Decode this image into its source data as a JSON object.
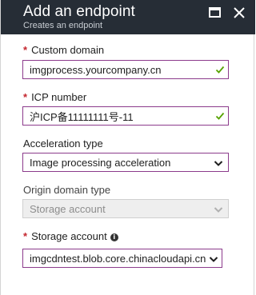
{
  "header": {
    "title": "Add an endpoint",
    "subtitle": "Creates an endpoint",
    "maximize_icon": "maximize-icon",
    "close_icon": "close-icon",
    "background_color": "#262d36"
  },
  "form": {
    "required_marker": "*",
    "custom_domain": {
      "label": "Custom domain",
      "value": "imgprocess.yourcompany.cn",
      "valid": true
    },
    "icp_number": {
      "label": "ICP number",
      "value": "沪ICP备11111111号-11",
      "valid": true
    },
    "acceleration_type": {
      "label": "Acceleration type",
      "selected": "Image processing acceleration"
    },
    "origin_domain_type": {
      "label": "Origin domain type",
      "selected": "Storage account",
      "disabled": true
    },
    "storage_account": {
      "label": "Storage account",
      "info_icon": "info-icon",
      "selected": "imgcdntest.blob.core.chinacloudapi.cn"
    }
  },
  "colors": {
    "accent_border": "#8c3b8c",
    "required": "#c4262e",
    "valid_check": "#57a300"
  }
}
